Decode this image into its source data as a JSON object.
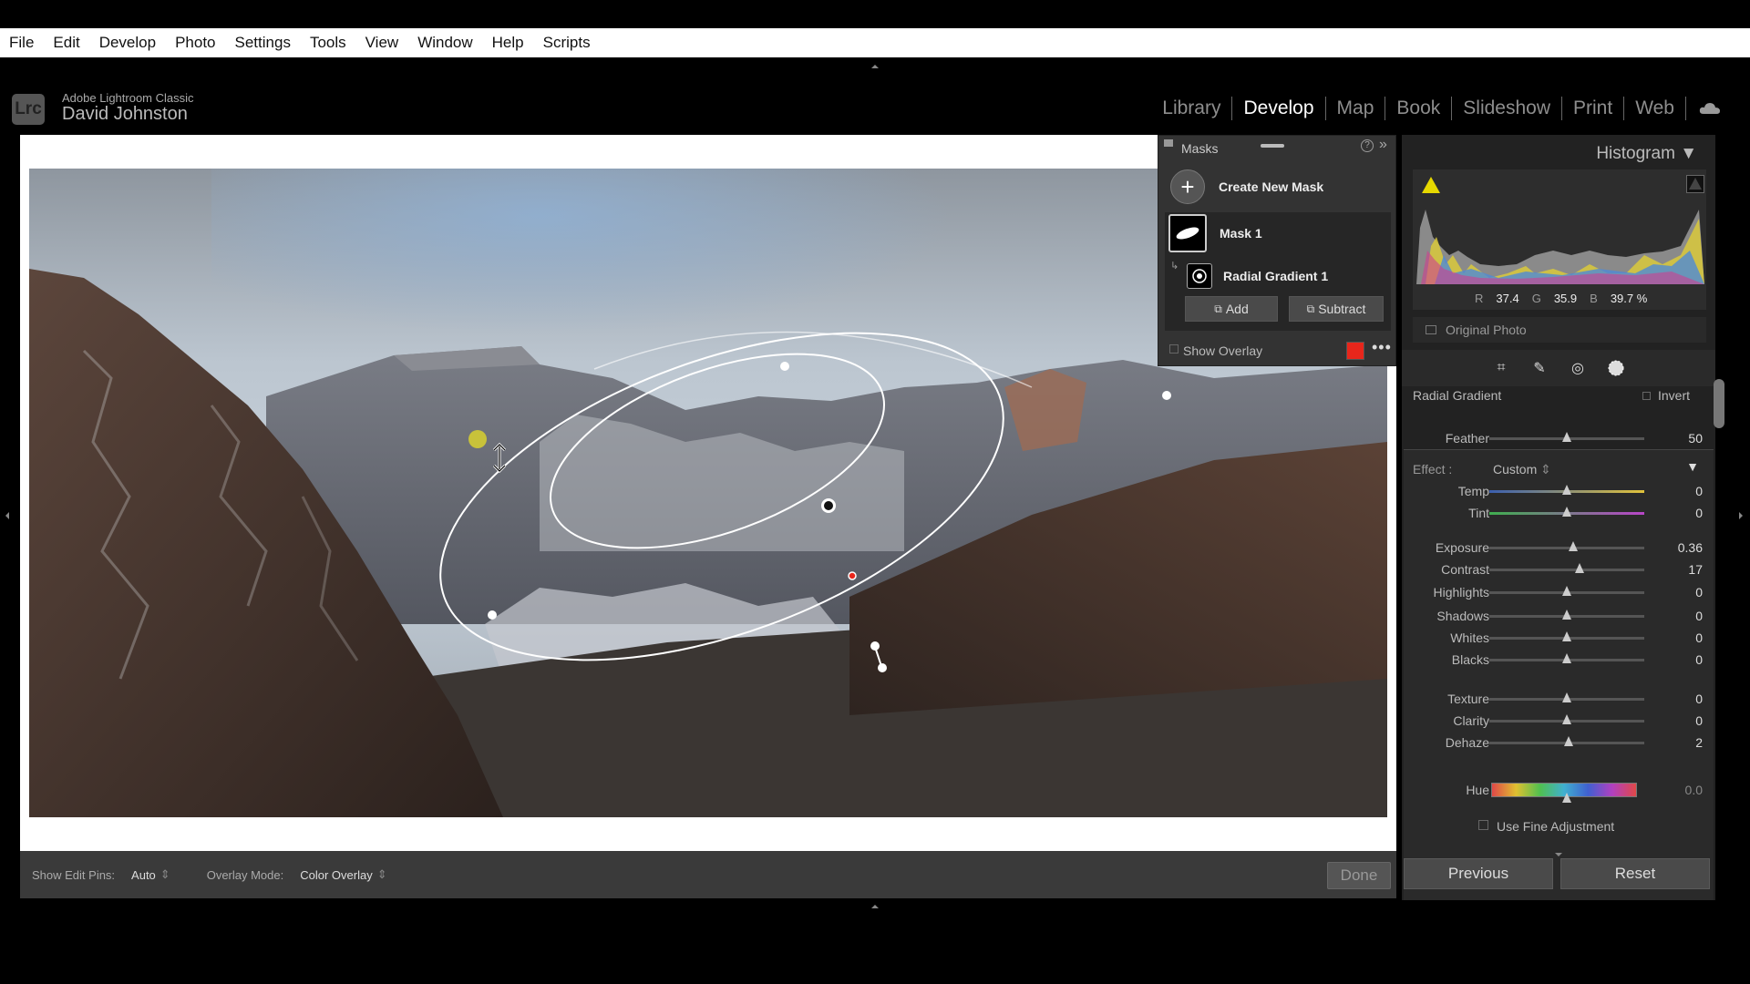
{
  "menu": [
    "File",
    "Edit",
    "Develop",
    "Photo",
    "Settings",
    "Tools",
    "View",
    "Window",
    "Help",
    "Scripts"
  ],
  "identity": {
    "logo": "Lrc",
    "app": "Adobe Lightroom Classic",
    "user": "David Johnston"
  },
  "modules": [
    "Library",
    "Develop",
    "Map",
    "Book",
    "Slideshow",
    "Print",
    "Web"
  ],
  "active_module": "Develop",
  "masks_panel": {
    "title": "Masks",
    "create_label": "Create New Mask",
    "mask1": "Mask 1",
    "radial": "Radial Gradient 1",
    "add": "Add",
    "subtract": "Subtract",
    "show_overlay": "Show Overlay",
    "overlay_color": "#e8261b"
  },
  "toolbar": {
    "pins_label": "Show Edit Pins:",
    "pins_value": "Auto",
    "overlay_label": "Overlay Mode:",
    "overlay_value": "Color Overlay",
    "done": "Done"
  },
  "histogram": {
    "title": "Histogram",
    "r_label": "R",
    "r": "37.4",
    "g_label": "G",
    "g": "35.9",
    "b_label": "B",
    "b": "39.7 %",
    "original_photo": "Original Photo"
  },
  "radial": {
    "title": "Radial Gradient",
    "invert": "Invert",
    "feather_label": "Feather",
    "feather_value": "50",
    "effect_label": "Effect :",
    "effect_value": "Custom"
  },
  "sliders": [
    {
      "name": "Temp",
      "value": "0",
      "pos": 0.5
    },
    {
      "name": "Tint",
      "value": "0",
      "pos": 0.5
    },
    {
      "name": "Exposure",
      "value": "0.36",
      "pos": 0.54
    },
    {
      "name": "Contrast",
      "value": "17",
      "pos": 0.58
    },
    {
      "name": "Highlights",
      "value": "0",
      "pos": 0.5
    },
    {
      "name": "Shadows",
      "value": "0",
      "pos": 0.5
    },
    {
      "name": "Whites",
      "value": "0",
      "pos": 0.5
    },
    {
      "name": "Blacks",
      "value": "0",
      "pos": 0.5
    },
    {
      "name": "Texture",
      "value": "0",
      "pos": 0.5
    },
    {
      "name": "Clarity",
      "value": "0",
      "pos": 0.5
    },
    {
      "name": "Dehaze",
      "value": "2",
      "pos": 0.51
    },
    {
      "name": "Hue",
      "value": "0.0",
      "pos": 0.5
    }
  ],
  "fine_adjustment": "Use Fine Adjustment",
  "buttons": {
    "previous": "Previous",
    "reset": "Reset"
  },
  "accent": "#e8261b"
}
